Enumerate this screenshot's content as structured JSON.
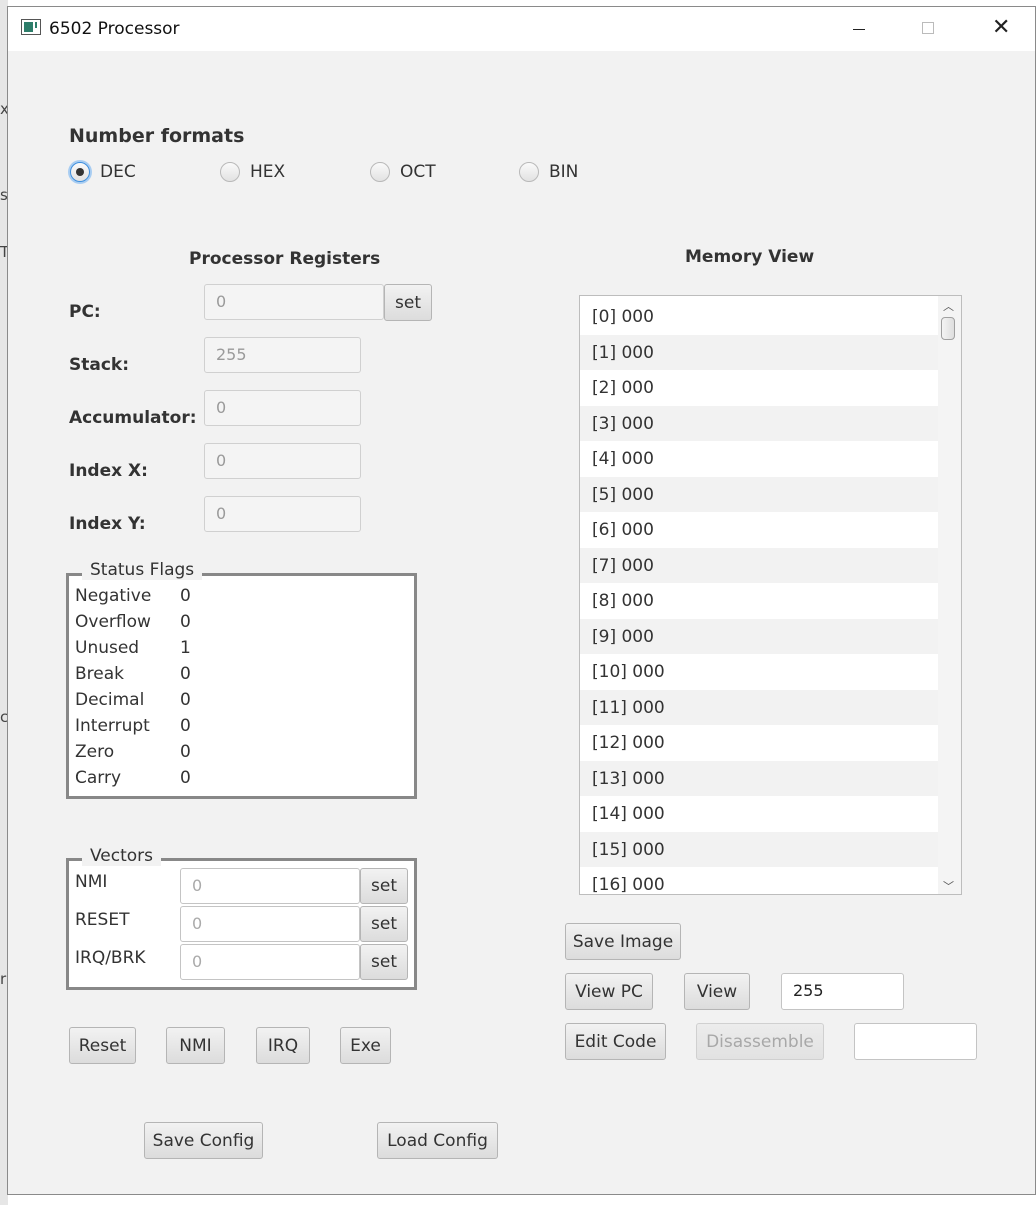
{
  "window": {
    "title": "6502 Processor"
  },
  "number_formats": {
    "title": "Number formats",
    "options": [
      {
        "label": "DEC",
        "selected": true
      },
      {
        "label": "HEX",
        "selected": false
      },
      {
        "label": "OCT",
        "selected": false
      },
      {
        "label": "BIN",
        "selected": false
      }
    ]
  },
  "registers": {
    "title": "Processor Registers",
    "pc": {
      "label": "PC:",
      "value": "0",
      "set_label": "set"
    },
    "stack": {
      "label": "Stack:",
      "value": "255"
    },
    "accumulator": {
      "label": "Accumulator:",
      "value": "0"
    },
    "index_x": {
      "label": "Index X:",
      "value": "0"
    },
    "index_y": {
      "label": "Index Y:",
      "value": "0"
    }
  },
  "status_flags": {
    "title": "Status Flags",
    "flags": [
      {
        "name": "Negative",
        "value": "0"
      },
      {
        "name": "Overflow",
        "value": "0"
      },
      {
        "name": "Unused",
        "value": "1"
      },
      {
        "name": "Break",
        "value": "0"
      },
      {
        "name": "Decimal",
        "value": "0"
      },
      {
        "name": "Interrupt",
        "value": "0"
      },
      {
        "name": "Zero",
        "value": "0"
      },
      {
        "name": "Carry",
        "value": "0"
      }
    ]
  },
  "vectors": {
    "title": "Vectors",
    "items": [
      {
        "label": "NMI",
        "value": "0",
        "set_label": "set"
      },
      {
        "label": "RESET",
        "value": "0",
        "set_label": "set"
      },
      {
        "label": "IRQ/BRK",
        "value": "0",
        "set_label": "set"
      }
    ]
  },
  "actions": {
    "reset": "Reset",
    "nmi": "NMI",
    "irq": "IRQ",
    "exe": "Exe"
  },
  "config": {
    "save": "Save Config",
    "load": "Load Config"
  },
  "memory": {
    "title": "Memory View",
    "rows": [
      "[0] 000",
      "[1] 000",
      "[2] 000",
      "[3] 000",
      "[4] 000",
      "[5] 000",
      "[6] 000",
      "[7] 000",
      "[8] 000",
      "[9] 000",
      "[10] 000",
      "[11] 000",
      "[12] 000",
      "[13] 000",
      "[14] 000",
      "[15] 000",
      "[16] 000"
    ],
    "save_image": "Save Image",
    "view_pc": "View PC",
    "view": "View",
    "view_address": "255",
    "edit_code": "Edit Code",
    "disassemble": "Disassemble",
    "disassemble_input": ""
  },
  "background_glyphs": [
    "x",
    "s",
    "T",
    "c",
    "r"
  ]
}
